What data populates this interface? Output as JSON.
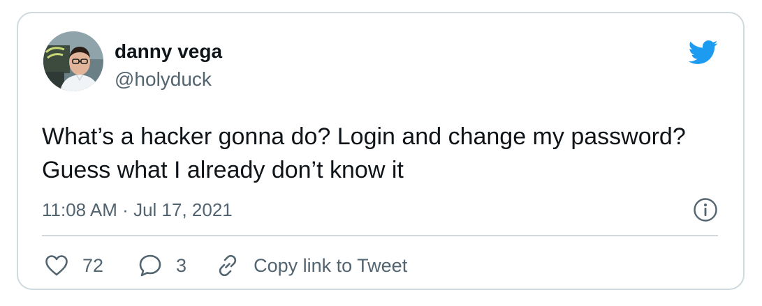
{
  "tweet": {
    "author": {
      "display_name": "danny vega",
      "handle": "@holyduck",
      "avatar_icon": "profile-photo"
    },
    "text": "What’s a hacker gonna do? Login and change my password? Guess what I already don’t know it",
    "timestamp": "11:08 AM",
    "separator": "·",
    "date": "Jul 17, 2021",
    "brand_icon": "twitter-bird-icon",
    "info_icon": "info-icon",
    "actions": {
      "like_count": "72",
      "reply_count": "3",
      "copy_link_label": "Copy link to Tweet"
    }
  },
  "colors": {
    "twitter_blue": "#1d9bf0",
    "text_primary": "#0f1419",
    "text_secondary": "#536471",
    "border": "#cfd9de"
  }
}
